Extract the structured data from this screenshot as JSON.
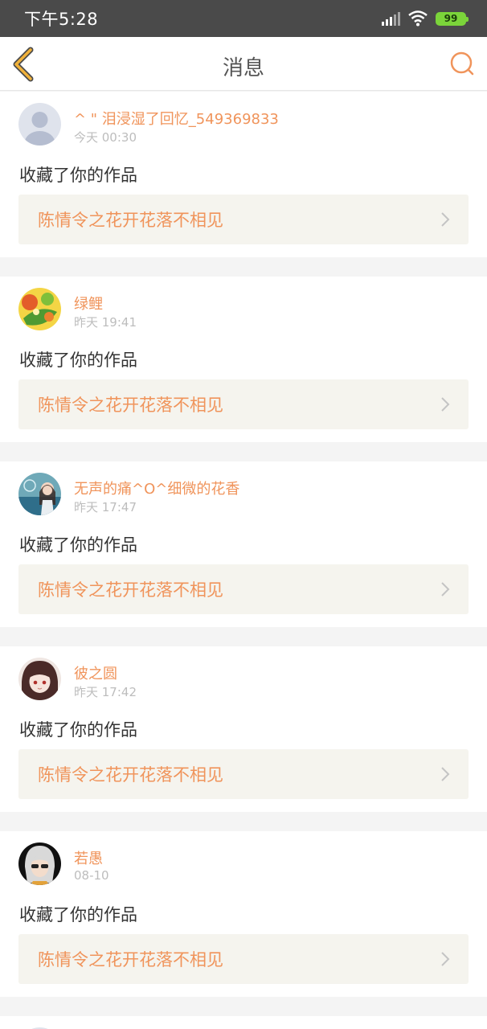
{
  "status_bar": {
    "time": "下午5:28",
    "battery": "99"
  },
  "header": {
    "title": "消息",
    "back_icon": "back-chevron-icon",
    "search_icon": "search-icon"
  },
  "colors": {
    "accent": "#f0945b",
    "back": "#f0a24a",
    "card_link_bg": "#f5f4ee"
  },
  "messages": [
    {
      "username": "^ \" 泪浸湿了回忆_549369833",
      "time": "今天 00:30",
      "action": "收藏了你的作品",
      "work_title": "陈情令之花开花落不相见",
      "avatar": "default-avatar"
    },
    {
      "username": "绿鲤",
      "time": "昨天 19:41",
      "action": "收藏了你的作品",
      "work_title": "陈情令之花开花落不相见",
      "avatar": "fish-avatar"
    },
    {
      "username": "无声的痛^O^细微的花香",
      "time": "昨天 17:47",
      "action": "收藏了你的作品",
      "work_title": "陈情令之花开花落不相见",
      "avatar": "girl-avatar"
    },
    {
      "username": "彼之圆",
      "time": "昨天 17:42",
      "action": "收藏了你的作品",
      "work_title": "陈情令之花开花落不相见",
      "avatar": "anime-girl-avatar"
    },
    {
      "username": "若愚",
      "time": "08-10",
      "action": "收藏了你的作品",
      "work_title": "陈情令之花开花落不相见",
      "avatar": "silver-hair-avatar"
    }
  ]
}
